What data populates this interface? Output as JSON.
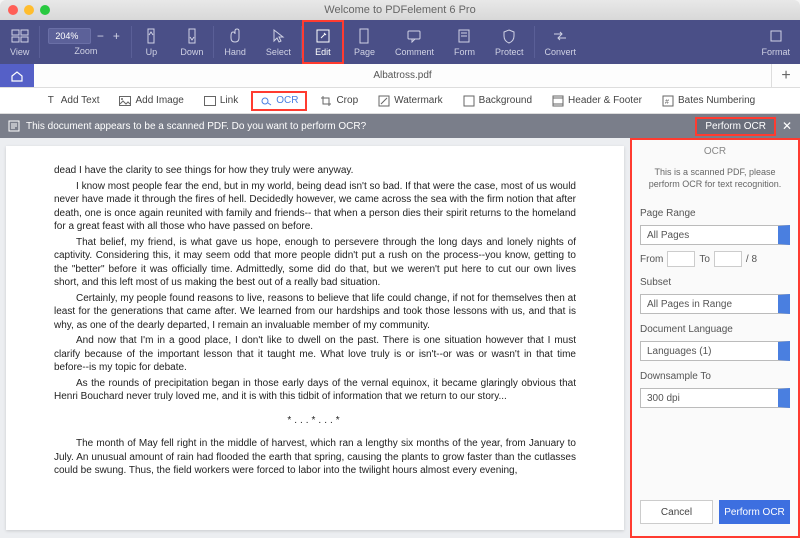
{
  "title": "Welcome to PDFelement 6 Pro",
  "ribbon": {
    "view": "View",
    "zoom_label": "Zoom",
    "zoom_value": "204%",
    "up": "Up",
    "down": "Down",
    "hand": "Hand",
    "select": "Select",
    "edit": "Edit",
    "page": "Page",
    "comment": "Comment",
    "form": "Form",
    "protect": "Protect",
    "convert": "Convert",
    "format": "Format"
  },
  "tabs": {
    "file": "Albatross.pdf"
  },
  "subtool": {
    "add_text": "Add Text",
    "add_image": "Add Image",
    "link": "Link",
    "ocr": "OCR",
    "crop": "Crop",
    "watermark": "Watermark",
    "background": "Background",
    "header_footer": "Header & Footer",
    "bates": "Bates Numbering"
  },
  "banner": {
    "msg": "This document appears to be a scanned PDF. Do you want to perform OCR?",
    "btn": "Perform OCR"
  },
  "panel": {
    "title": "OCR",
    "hint": "This is a scanned PDF, please perform OCR for text recognition.",
    "page_range_label": "Page Range",
    "page_range_value": "All Pages",
    "from_label": "From",
    "to_label": "To",
    "total_pages": "/ 8",
    "subset_label": "Subset",
    "subset_value": "All Pages in Range",
    "lang_label": "Document Language",
    "lang_value": "Languages (1)",
    "downsample_label": "Downsample To",
    "downsample_value": "300 dpi",
    "cancel": "Cancel",
    "perform": "Perform OCR"
  },
  "doc": {
    "p1": "dead I have the clarity to see things for how they truly were anyway.",
    "p2": "I know most people fear the end, but in my world, being dead isn't so bad. If that were the case, most of us would never have made it through the fires of hell. Decidedly however, we came across the sea with the firm notion that after death, one is once again reunited with family and friends-- that when a person dies their spirit returns to the homeland for a great feast with all those who have passed on before.",
    "p3": "That belief, my friend, is what gave us hope, enough to persevere through the long days and lonely nights of captivity. Considering this, it may seem odd that more people didn't put a rush on the process--you know, getting to the \"better\" before it was officially time. Admittedly, some did do that, but we weren't put here to cut our own lives short, and this left most of us making the best out of a really bad situation.",
    "p4": "Certainly, my people found reasons to live, reasons to believe that life could change, if not for themselves then at least for the generations that came after. We learned from our hardships and took those lessons with us, and that is why, as one of the dearly departed, I remain an invaluable member of my community.",
    "p5": "And now that I'm in a good place, I don't like to dwell on the past. There is one situation however that I must clarify because of the important lesson that it taught me. What love truly is or isn't--or was or wasn't in that time before--is my topic for debate.",
    "p6": "As the rounds of precipitation began in those early days of the vernal equinox, it became glaringly obvious that Henri Bouchard never truly loved me, and it is with this tidbit of information that we return to our story...",
    "ast": "*...*...*",
    "p7": "The month of May fell right in the middle of harvest, which ran a lengthy six months of the year, from January to July. An unusual amount of rain had flooded the earth that spring, causing the plants to grow faster than the cutlasses could be swung. Thus, the field workers were forced to labor into the twilight hours almost every evening,"
  }
}
